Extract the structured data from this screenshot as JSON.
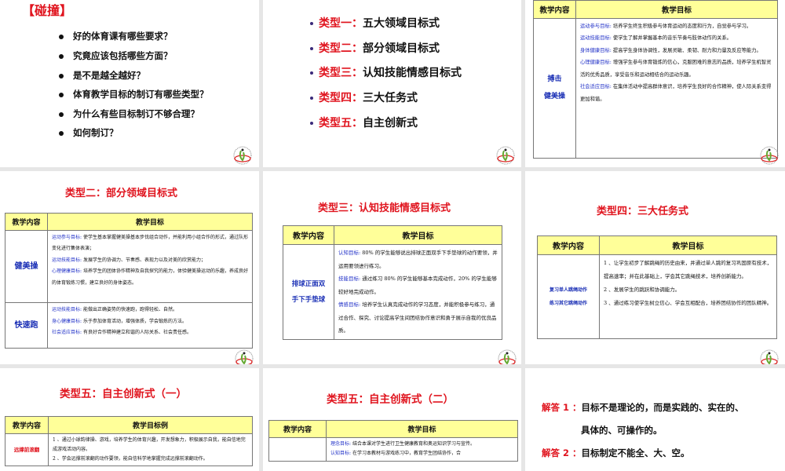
{
  "colors": {
    "title_red": "#e0141e",
    "table_header": "#ffff99",
    "label_blue": "#2232c8",
    "gap": "#e6e6e6"
  },
  "logo_icon": "school-logo-icon",
  "slide1": {
    "title": "【碰撞】",
    "items": [
      "好的体育课有哪些要求？",
      "究竟应该包括哪些方面？",
      "是不是越全越好？",
      "体育教学目标的制订有哪些类型？",
      "为什么有些目标制订不够合理？",
      "如何制订？"
    ]
  },
  "slide2": {
    "items": [
      {
        "label": "类型一：",
        "text": "五大领域目标式"
      },
      {
        "label": "类型二：",
        "text": "部分领域目标式"
      },
      {
        "label": "类型三：",
        "text": "认知技能情感目标式"
      },
      {
        "label": "类型四：",
        "text": "三大任务式"
      },
      {
        "label": "类型五：",
        "text": "自主创新式"
      }
    ]
  },
  "slide3": {
    "headers": [
      "教学内容",
      "教学目标"
    ],
    "rows": [
      {
        "content": [
          "搏击",
          "健美操"
        ],
        "goals": [
          {
            "label": "运动参与目标:",
            "text": " 培养学生终生积极参与体育运动的态度和行为，自觉参与学习。"
          },
          {
            "label": "运动技能目标:",
            "text": " 使学生了解并掌握基本的音乐节奏与肢体动作的关系。"
          },
          {
            "label": "身体健康目标:",
            "text": " 提高学生身体协调性，发展灵敏、柔韧、耐力和力量及反应等能力。"
          },
          {
            "label": "心理健康目标:",
            "text": " 增强学生参与体育锻炼的信心，克服困难的意志的品质，培养学生机智灵活的优秀品质，享受音乐和运动相结合的运动乐趣。"
          },
          {
            "label": "社会适应目标:",
            "text": " 在集体活动中提高群体意识，培养学生良好的合作精神，使人际关系变得更加和谐。"
          }
        ]
      }
    ]
  },
  "slide4": {
    "title": "类型二：部分领域目标式",
    "headers": [
      "教学内容",
      "教学目标"
    ],
    "rows": [
      {
        "content": [
          "健美操"
        ],
        "goals": [
          {
            "label": "运动参与目标:",
            "text": " 使学生基本掌握健美操基本步伐组合动作，并能利用小组合作的形式，通过队形变化进行集体表演；"
          },
          {
            "label": "运动技能目标:",
            "text": " 发展学生的协调力、节奏感、表现力以及对美的欣赏能力；"
          },
          {
            "label": "心理健康目标:",
            "text": " 培养学生的团体协作精神及自我探究的能力，体验健美操运动的乐趣，养成良好的体育锻炼习惯，建立良好的身体姿态。"
          }
        ]
      },
      {
        "content": [
          "快速跑"
        ],
        "goals": [
          {
            "label": "运动技能目标:",
            "text": " 能做出正确姿势的快速跑，跑得轻松、自然。"
          },
          {
            "label": "身心健康目标:",
            "text": " 乐于参加体育活动，增强体质，学会锻炼的方法。"
          },
          {
            "label": "社会适应目标:",
            "text": " 有良好合作精神建立和谐的人际关系、社会责任感。"
          }
        ]
      }
    ]
  },
  "slide5": {
    "title": "类型三：认知技能情感目标式",
    "headers": [
      "教学内容",
      "教学目标"
    ],
    "rows": [
      {
        "content": [
          "排球正面双",
          "手下手垫球"
        ],
        "goals": [
          {
            "label": "认知目标:",
            "text": "  80% 的学生能够说出排球正面双手下手垫球的动作要领，并运用要领进行练习。"
          },
          {
            "label": "技能目标:",
            "text": " 通过练习 80% 的学生能够基本完成动作，20% 的学生能够较好地完成动作。"
          },
          {
            "label": "情感目标:",
            "text": " 培养学生认真完成动作的学习态度，并能积极参与练习，通过合作、探究、讨论提高学生间团结协作意识和勇于展示自我的优良品质。"
          }
        ]
      }
    ]
  },
  "slide6": {
    "title": "类型四：三大任务式",
    "headers": [
      "教学内容",
      "教学目标"
    ],
    "rows": [
      {
        "content": [
          "复习单人跳绳动作",
          "练习其它跳绳动作"
        ],
        "goals": [
          {
            "label": "",
            "text": "1 、让学生初步了解跳绳的历史由来，并通过单人跳的复习巩固原有技术，提高速率；并在此基础上，学会其它跳绳技术，培养创新能力。"
          },
          {
            "label": "",
            "text": "2 、发展学生的跳跃和协调能力。"
          },
          {
            "label": "",
            "text": "3 、通过练习使学生树立信心、学会互相配合，培养团结协作的团队精神。"
          }
        ]
      }
    ]
  },
  "slide7": {
    "title": "类型五：自主创新式（一）",
    "headers": [
      "教学内容",
      "教学目标例"
    ],
    "rows": [
      {
        "content": [
          "远撑前滚翻"
        ],
        "goals": [
          {
            "label": "",
            "text": "1 、通过小球韵律操、游戏，培养学生的体育兴趣，开发想象力，积极展示自我，能自信地完成游戏活动内容。"
          },
          {
            "label": "",
            "text": "2 、学会远撑前滚翻的动作要领，能自信科学地掌握完成远撑前滚翻动作。"
          }
        ]
      }
    ]
  },
  "slide8": {
    "title": "类型五：自主创新式（二）",
    "headers": [
      "教学内容",
      "教学目标"
    ],
    "rows": [
      {
        "content": [
          ""
        ],
        "goals": [
          {
            "label": "理念目标:",
            "text": " 结合本课对学生进行卫生健康教育和奥运知识学习与宣传。"
          },
          {
            "label": "认知目标:",
            "text": " 在学习本教材与游戏练习中，教育学生团结协作，合"
          }
        ]
      }
    ]
  },
  "slide9": {
    "answers": [
      {
        "label": "解答 1 ：",
        "lines": [
          "目标不是理论的，而是实践的、实在的、",
          "具体的、可操作的。"
        ]
      },
      {
        "label": "解答 2 ：",
        "lines": [
          "目标制定不能全、大、空。"
        ]
      }
    ]
  }
}
